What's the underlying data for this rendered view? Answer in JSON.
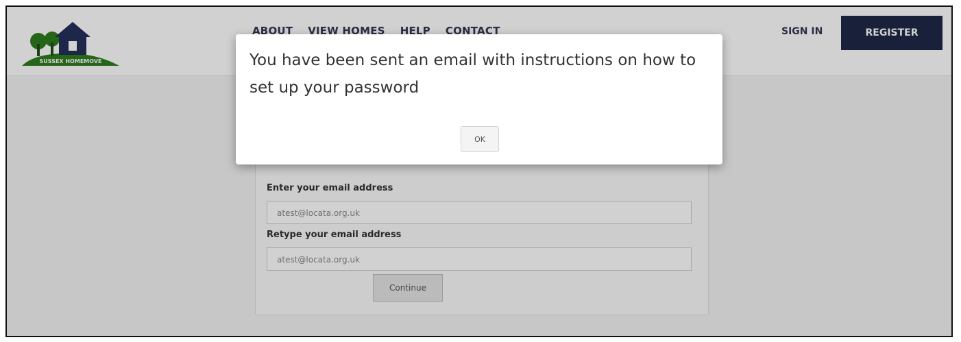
{
  "header": {
    "logo_text": "SUSSEX HOMEMOVE",
    "nav": [
      "ABOUT",
      "VIEW HOMES",
      "HELP",
      "CONTACT"
    ],
    "sign_in": "SIGN IN",
    "register": "REGISTER"
  },
  "form": {
    "email_label": "Enter your email address",
    "email_value": "atest@locata.org.uk",
    "retype_label": "Retype your email address",
    "retype_value": "atest@locata.org.uk",
    "continue_label": "Continue"
  },
  "dialog": {
    "message": "You have been sent an email with instructions on how to set up your password",
    "ok_label": "OK"
  },
  "colors": {
    "brand_navy": "#1f2947",
    "logo_green": "#2f7d1f"
  }
}
